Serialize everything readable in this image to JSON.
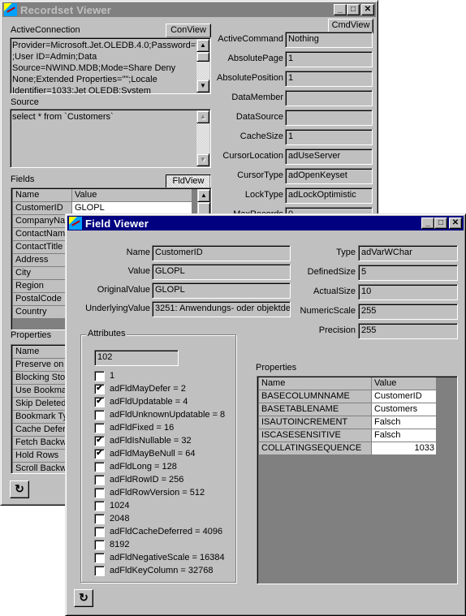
{
  "recordset_viewer": {
    "title": "Recordset Viewer",
    "active_connection_label": "ActiveConnection",
    "conview_button": "ConView",
    "active_connection_value": "Provider=Microsoft.Jet.OLEDB.4.0;Password=\"\"\n;User ID=Admin;Data\nSource=NWIND.MDB;Mode=Share Deny\nNone;Extended Properties=\"\";Locale\nIdentifier=1033;Jet OLEDB:System",
    "source_label": "Source",
    "source_value": "select * from `Customers`",
    "fields_label": "Fields",
    "fldview_button": "FldView",
    "fields_grid": {
      "headers": [
        "Name",
        "Value"
      ],
      "rows": [
        {
          "name": "CustomerID",
          "value": "GLOPL"
        },
        {
          "name": "CompanyName",
          "value": ""
        },
        {
          "name": "ContactName",
          "value": ""
        },
        {
          "name": "ContactTitle",
          "value": ""
        },
        {
          "name": "Address",
          "value": ""
        },
        {
          "name": "City",
          "value": ""
        },
        {
          "name": "Region",
          "value": ""
        },
        {
          "name": "PostalCode",
          "value": ""
        },
        {
          "name": "Country",
          "value": ""
        }
      ]
    },
    "properties_label": "Properties",
    "properties_grid": {
      "header": "Name",
      "rows": [
        "Preserve on Abort",
        "Blocking Storage Objects",
        "Use Bookmarks",
        "Skip Deleted Bookmarks",
        "Bookmark Type",
        "Cache Deferred Columns",
        "Fetch Backwards",
        "Hold Rows",
        "Scroll Backwards"
      ]
    },
    "cmdview_button": "CmdView",
    "props": [
      {
        "label": "ActiveCommand",
        "value": "Nothing"
      },
      {
        "label": "AbsolutePage",
        "value": "1"
      },
      {
        "label": "AbsolutePosition",
        "value": "1"
      },
      {
        "label": "DataMember",
        "value": ""
      },
      {
        "label": "DataSource",
        "value": ""
      },
      {
        "label": "CacheSize",
        "value": "1"
      },
      {
        "label": "CursorLocation",
        "value": "adUseServer"
      },
      {
        "label": "CursorType",
        "value": "adOpenKeyset"
      },
      {
        "label": "LockType",
        "value": "adLockOptimistic"
      },
      {
        "label": "MaxRecords",
        "value": "0"
      }
    ]
  },
  "field_viewer": {
    "title": "Field Viewer",
    "left_props": [
      {
        "label": "Name",
        "value": "CustomerID"
      },
      {
        "label": "Value",
        "value": "GLOPL"
      },
      {
        "label": "OriginalValue",
        "value": "GLOPL"
      },
      {
        "label": "UnderlyingValue",
        "value": "3251: Anwendungs- oder objektde"
      }
    ],
    "right_props": [
      {
        "label": "Type",
        "value": "adVarWChar"
      },
      {
        "label": "DefinedSize",
        "value": "5"
      },
      {
        "label": "ActualSize",
        "value": "10"
      },
      {
        "label": "NumericScale",
        "value": "255"
      },
      {
        "label": "Precision",
        "value": "255"
      }
    ],
    "attributes_label": "Attributes",
    "attributes_value": "102",
    "attributes": [
      {
        "label": "1",
        "checked": false
      },
      {
        "label": "adFldMayDefer = 2",
        "checked": true
      },
      {
        "label": "adFldUpdatable = 4",
        "checked": true
      },
      {
        "label": "adFldUnknownUpdatable = 8",
        "checked": false
      },
      {
        "label": "adFldFixed = 16",
        "checked": false
      },
      {
        "label": "adFldIsNullable = 32",
        "checked": true
      },
      {
        "label": "adFldMayBeNull = 64",
        "checked": true
      },
      {
        "label": "adFldLong = 128",
        "checked": false
      },
      {
        "label": "adFldRowID = 256",
        "checked": false
      },
      {
        "label": "adFldRowVersion = 512",
        "checked": false
      },
      {
        "label": "1024",
        "checked": false
      },
      {
        "label": "2048",
        "checked": false
      },
      {
        "label": "adFldCacheDeferred = 4096",
        "checked": false
      },
      {
        "label": "8192",
        "checked": false
      },
      {
        "label": "adFldNegativeScale = 16384",
        "checked": false
      },
      {
        "label": "adFldKeyColumn = 32768",
        "checked": false
      }
    ],
    "properties_label": "Properties",
    "properties_grid": {
      "headers": [
        "Name",
        "Value"
      ],
      "rows": [
        {
          "name": "BASECOLUMNNAME",
          "value": "CustomerID",
          "numeric": false
        },
        {
          "name": "BASETABLENAME",
          "value": "Customers",
          "numeric": false
        },
        {
          "name": "ISAUTOINCREMENT",
          "value": "Falsch",
          "numeric": false
        },
        {
          "name": "ISCASESENSITIVE",
          "value": "Falsch",
          "numeric": false
        },
        {
          "name": "COLLATINGSEQUENCE",
          "value": "1033",
          "numeric": true
        }
      ]
    }
  },
  "icons": {
    "minimize": "_",
    "maximize": "□",
    "close": "✕",
    "scroll_up": "▲",
    "scroll_down": "▼",
    "refresh": "↻",
    "check": "✔"
  }
}
